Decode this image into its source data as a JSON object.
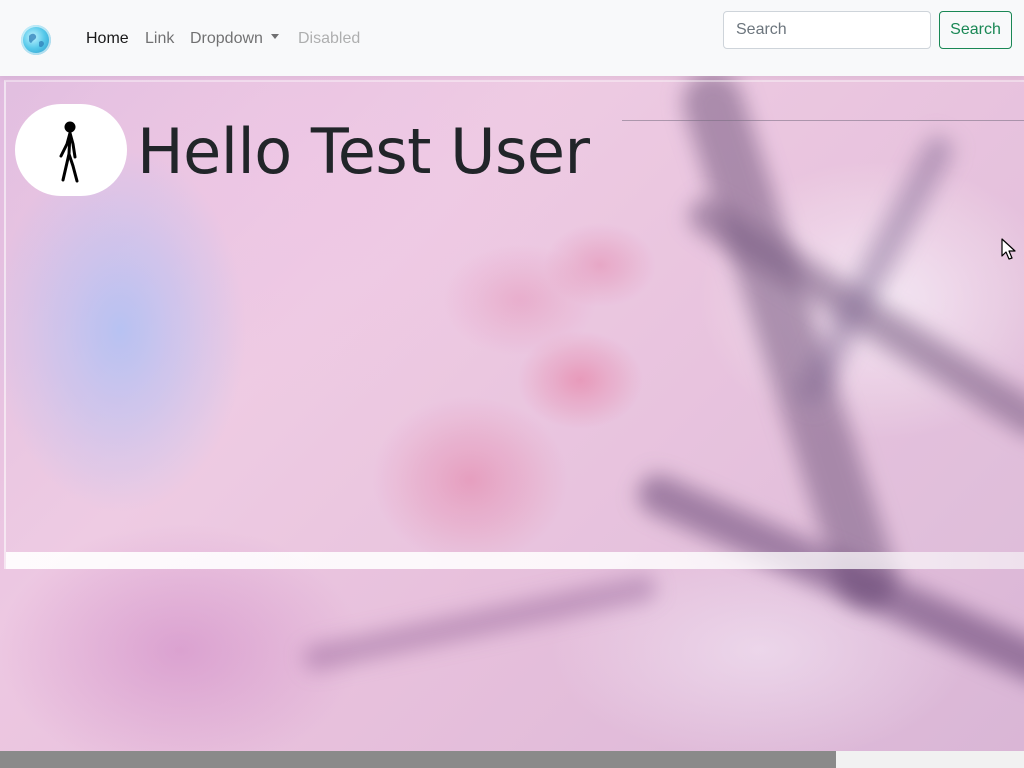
{
  "navbar": {
    "brand_icon": "globe-icon",
    "links": [
      {
        "label": "Home",
        "state": "active"
      },
      {
        "label": "Link",
        "state": "normal"
      },
      {
        "label": "Dropdown",
        "state": "dropdown"
      },
      {
        "label": "Disabled",
        "state": "disabled"
      }
    ],
    "search": {
      "placeholder": "Search",
      "value": "",
      "button_label": "Search"
    }
  },
  "hero": {
    "avatar_icon": "stick-figure-icon",
    "title": "Hello Test User"
  },
  "colors": {
    "navbar_bg": "#f8f9fa",
    "search_button_accent": "#198754",
    "title_text": "#212529",
    "background_tone": "#e9c7df"
  }
}
